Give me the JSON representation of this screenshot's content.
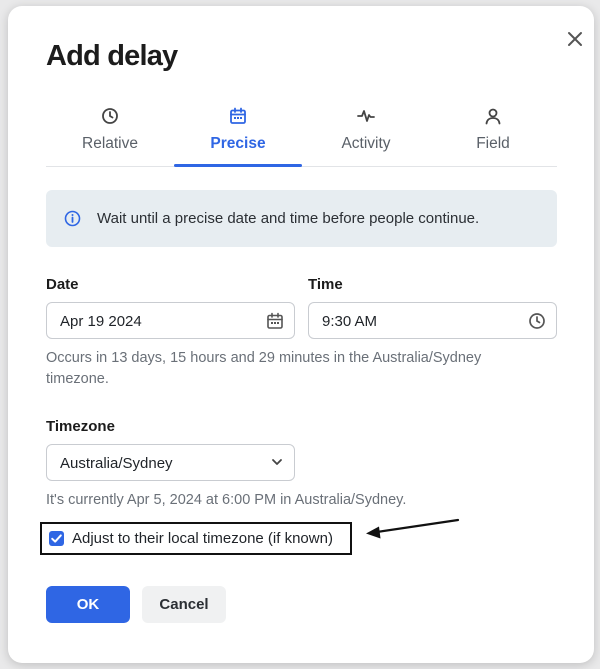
{
  "dialog": {
    "title": "Add delay",
    "close_icon": "close-icon"
  },
  "tabs": [
    {
      "label": "Relative",
      "icon": "clock-icon",
      "active": false
    },
    {
      "label": "Precise",
      "icon": "calendar-icon",
      "active": true
    },
    {
      "label": "Activity",
      "icon": "activity-icon",
      "active": false
    },
    {
      "label": "Field",
      "icon": "user-icon",
      "active": false
    }
  ],
  "info": {
    "icon": "info-icon",
    "text": "Wait until a precise date and time before people continue."
  },
  "date": {
    "label": "Date",
    "value": "Apr 19 2024",
    "icon": "calendar-icon"
  },
  "time": {
    "label": "Time",
    "value": "9:30 AM",
    "icon": "clock-icon"
  },
  "occurs_text": "Occurs in 13 days, 15 hours and 29 minutes in the Australia/Sydney timezone.",
  "timezone": {
    "label": "Timezone",
    "value": "Australia/Sydney",
    "icon": "chevron-down-icon"
  },
  "current_text": "It's currently Apr 5, 2024 at 6:00 PM in Australia/Sydney.",
  "adjust_checkbox": {
    "label": "Adjust to their local timezone (if known)",
    "checked": true
  },
  "buttons": {
    "ok": "OK",
    "cancel": "Cancel"
  },
  "colors": {
    "accent": "#2f66e4",
    "info_bg": "#e7edf1"
  }
}
